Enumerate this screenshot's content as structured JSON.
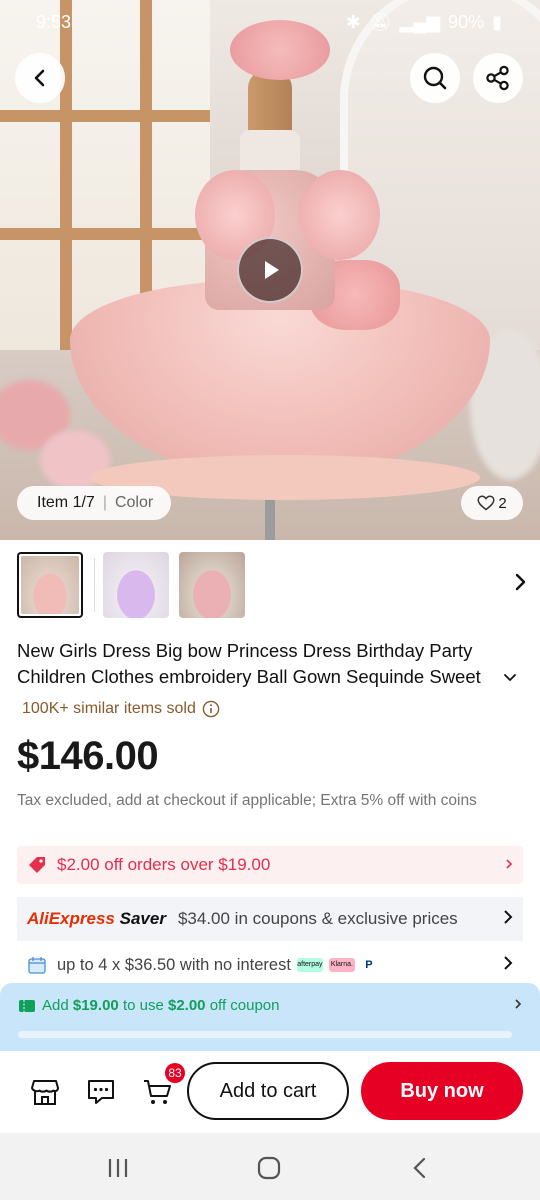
{
  "status_bar": {
    "time": "9:53",
    "battery": "90%"
  },
  "hero": {
    "item_position": "Item 1/7",
    "color_label": "Color",
    "like_count": "2"
  },
  "product": {
    "title_line1": "New Girls Dress Big bow Princess Dress Birthday Party",
    "title_line2": "Children Clothes embroidery Ball Gown Sequinde Sweet",
    "sold": "100K+ similar items sold",
    "price": "$146.00",
    "tax_note": "Tax excluded, add at checkout if applicable; Extra 5% off with coins"
  },
  "promo": {
    "text": "$2.00 off orders over $19.00"
  },
  "saver": {
    "brand_ali": "AliExpress",
    "brand_saver": "Saver",
    "text": "$34.00 in coupons & exclusive prices"
  },
  "installment": {
    "text": "up to 4 x $36.50 with no interest",
    "providers": [
      "afterpay",
      "Klarna.",
      "P"
    ]
  },
  "coupon_banner": {
    "prefix": "Add",
    "amount": "$19.00",
    "middle": "to use",
    "discount": "$2.00",
    "suffix": "off coupon"
  },
  "actions": {
    "cart_count": "83",
    "add_to_cart": "Add to cart",
    "buy_now": "Buy now"
  },
  "colors": {
    "accent_red": "#e60023",
    "promo_red": "#e62e4d",
    "coupon_green": "#10a05a",
    "coupon_bg": "#c9e5fa"
  }
}
